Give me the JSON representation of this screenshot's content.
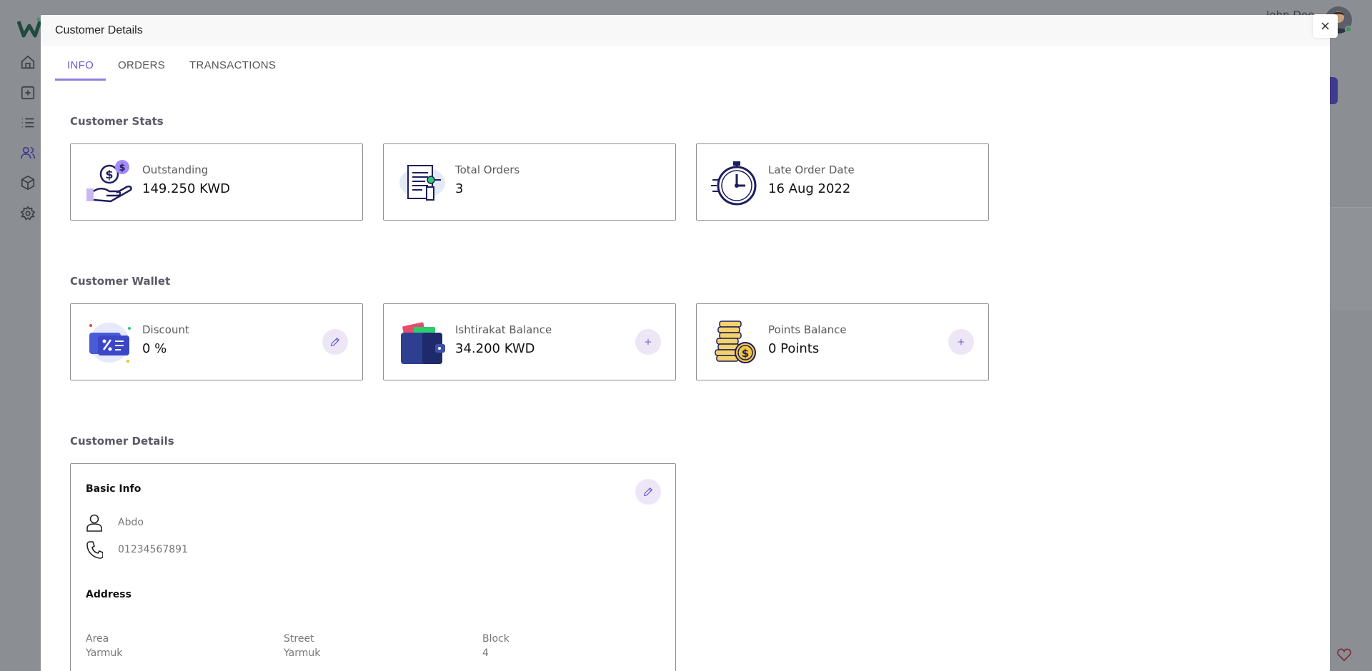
{
  "background": {
    "user_name": "John Doe"
  },
  "modal": {
    "title": "Customer Details",
    "close_label": "×",
    "tabs": [
      {
        "label": "INFO",
        "active": true
      },
      {
        "label": "ORDERS",
        "active": false
      },
      {
        "label": "TRANSACTIONS",
        "active": false
      }
    ]
  },
  "stats": {
    "title": "Customer Stats",
    "items": [
      {
        "label": "Outstanding",
        "value": "149.250 KWD",
        "icon": "money-hand-icon"
      },
      {
        "label": "Total Orders",
        "value": "3",
        "icon": "receipt-icon"
      },
      {
        "label": "Late Order Date",
        "value": "16 Aug 2022",
        "icon": "stopwatch-icon"
      }
    ]
  },
  "wallet": {
    "title": "Customer Wallet",
    "items": [
      {
        "label": "Discount",
        "value": "0 %",
        "icon": "discount-card-icon",
        "action": "edit-icon"
      },
      {
        "label": "Ishtirakat Balance",
        "value": "34.200 KWD",
        "icon": "wallet-icon",
        "action": "plus-icon"
      },
      {
        "label": "Points Balance",
        "value": "0 Points",
        "icon": "coins-icon",
        "action": "plus-icon"
      }
    ]
  },
  "details": {
    "title": "Customer Details",
    "basic_info": {
      "title": "Basic Info",
      "name": "Abdo",
      "phone": "01234567891"
    },
    "address": {
      "title": "Address",
      "area_label": "Area",
      "area_value": "Yarmuk",
      "street_label": "Street",
      "street_value": "Yarmuk",
      "block_label": "Block",
      "block_value": "4"
    }
  },
  "colors": {
    "accent": "#6a5acd",
    "action_bg": "#ece6f6",
    "overlay": "#8b8e93"
  }
}
